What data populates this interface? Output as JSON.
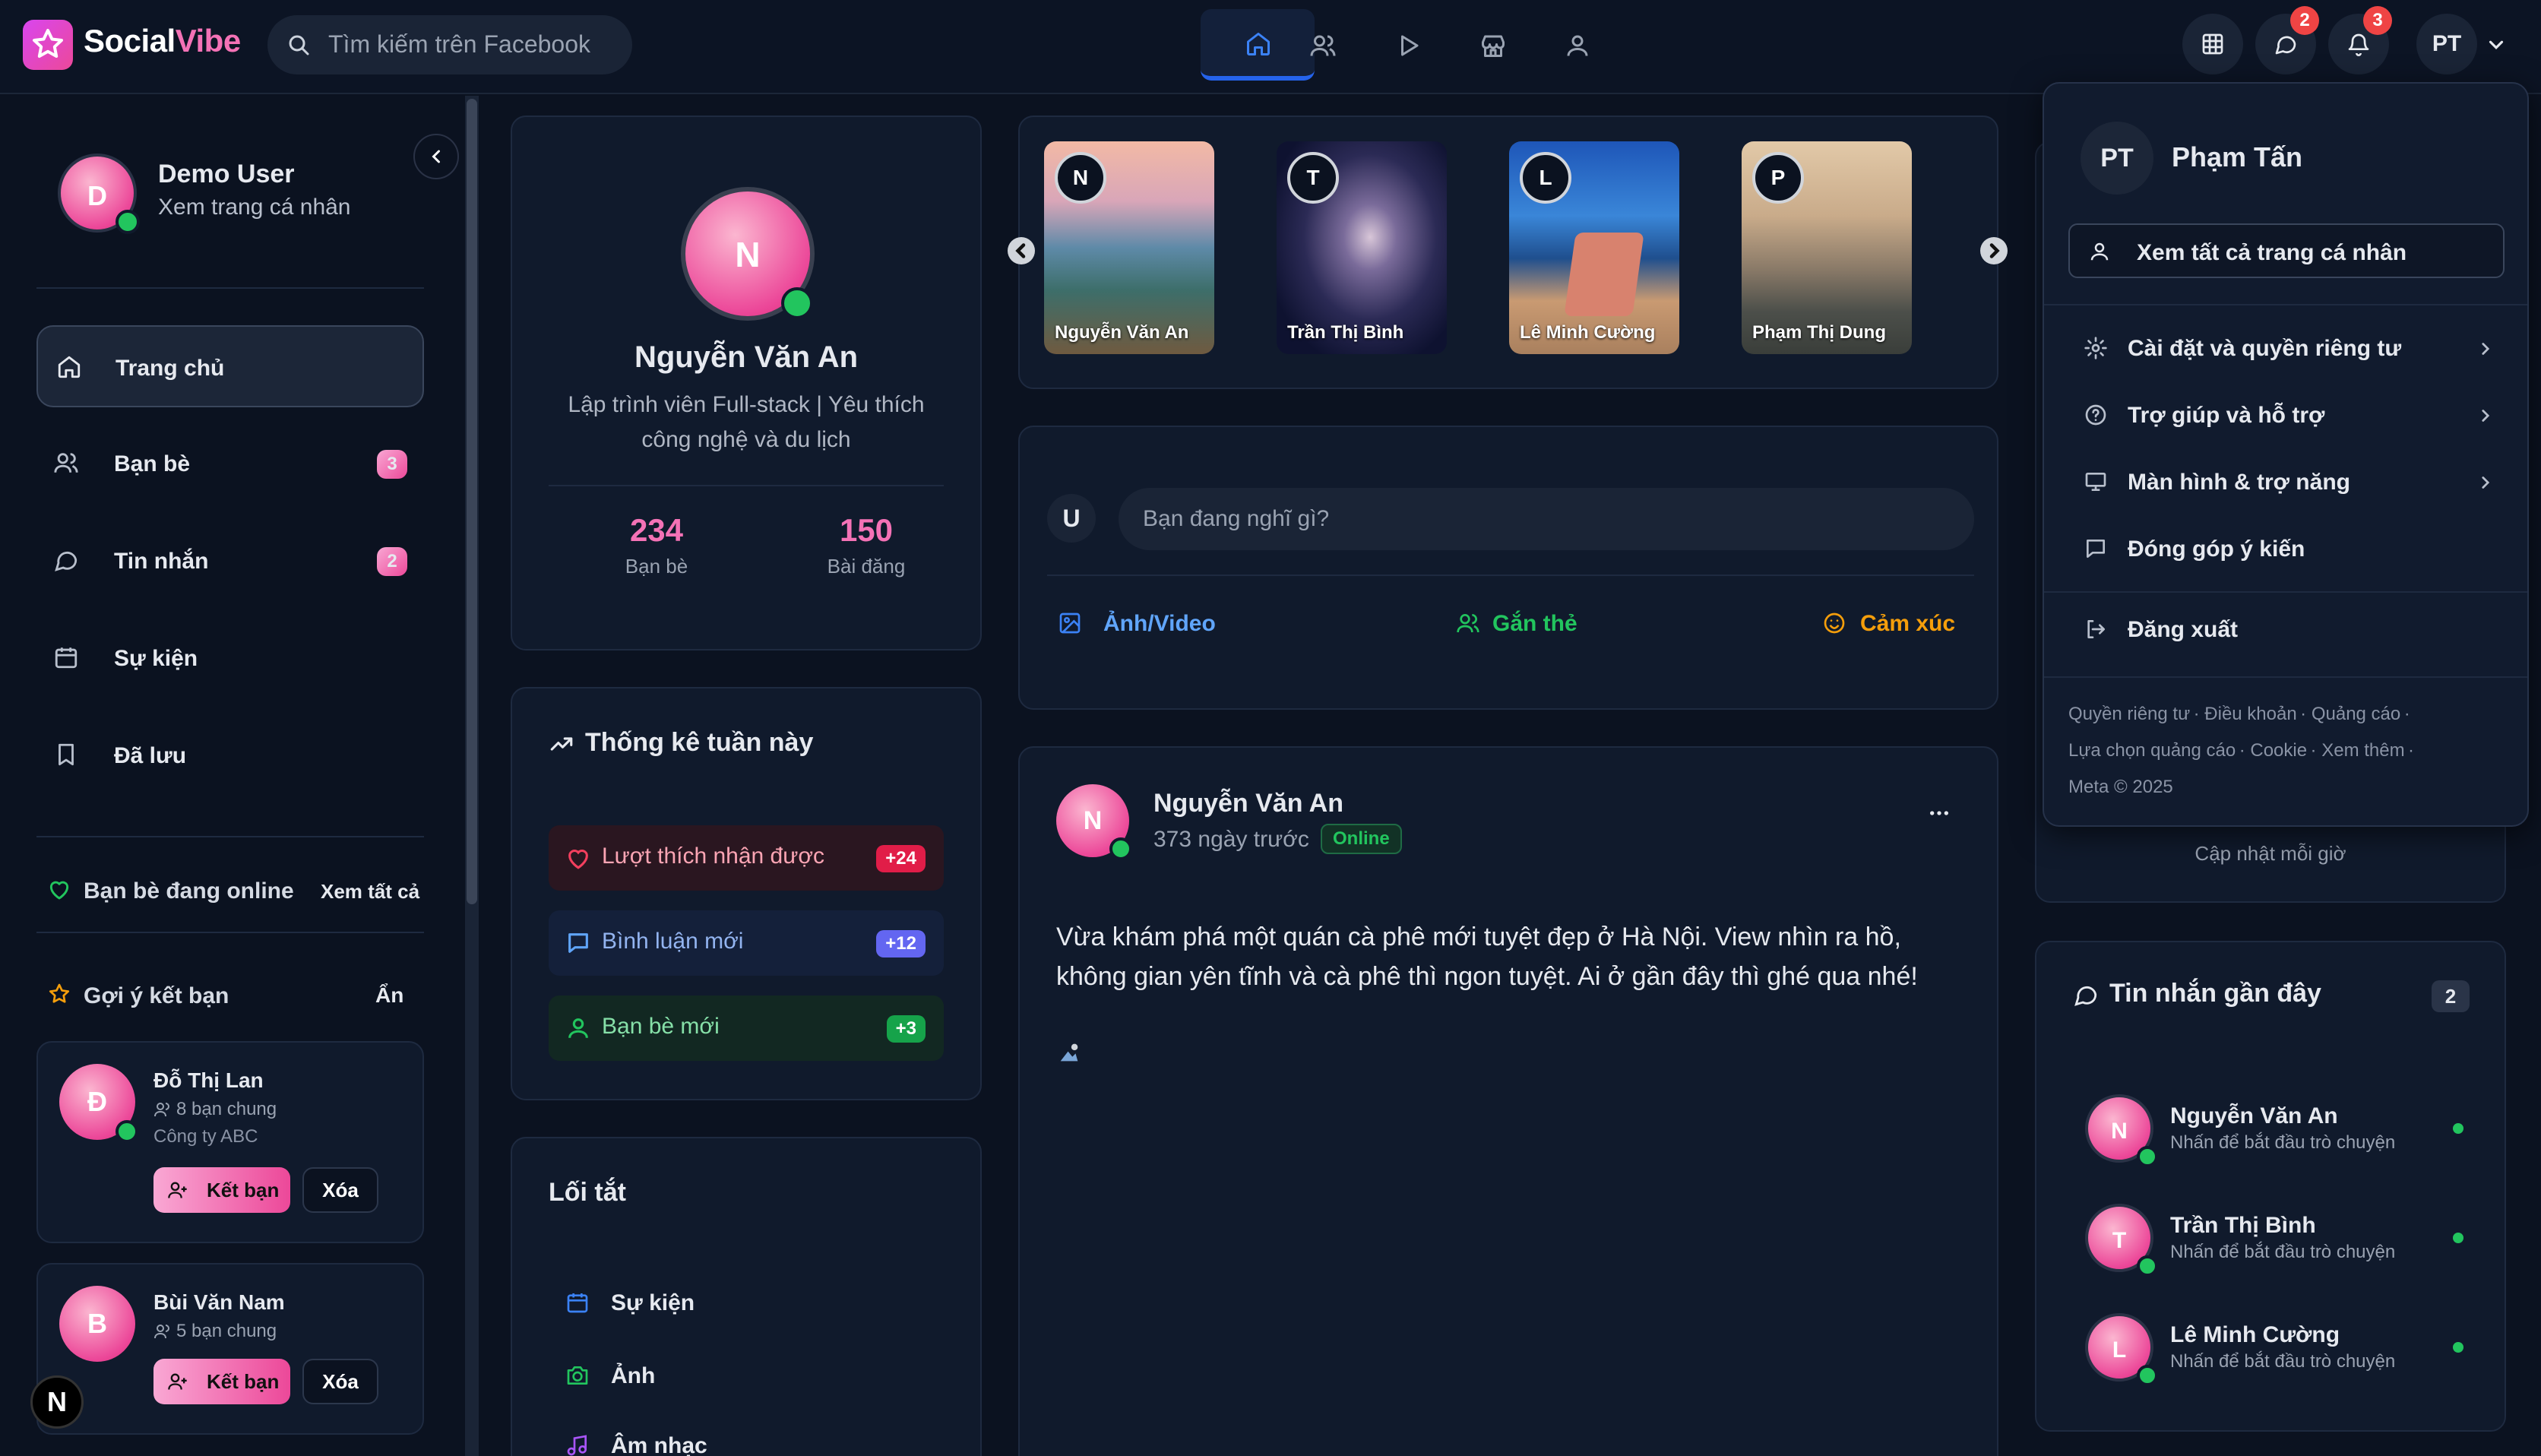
{
  "app": {
    "brand": "SocialVibe",
    "brand_a": "Social",
    "brand_b": "Vibe"
  },
  "search": {
    "placeholder": "Tìm kiếm trên Facebook"
  },
  "header": {
    "nav_tabs": [
      "home",
      "friends",
      "watch",
      "marketplace",
      "groups"
    ],
    "messages_badge": "2",
    "notifications_badge": "3",
    "user_initials": "PT"
  },
  "sidebar": {
    "user": {
      "initial": "D",
      "name": "Demo User",
      "subtitle": "Xem trang cá nhân"
    },
    "menu": [
      {
        "label": "Trang chủ",
        "icon": "home-icon"
      },
      {
        "label": "Bạn bè",
        "icon": "users-icon",
        "badge": "3"
      },
      {
        "label": "Tin nhắn",
        "icon": "message-icon",
        "badge": "2"
      },
      {
        "label": "Sự kiện",
        "icon": "calendar-icon"
      },
      {
        "label": "Đã lưu",
        "icon": "bookmark-icon"
      }
    ],
    "online_title": "Bạn bè đang online",
    "online_link": "Xem tất cả",
    "suggest_title": "Gợi ý kết bạn",
    "suggest_hide": "Ẩn",
    "suggestions": [
      {
        "initial": "Đ",
        "name": "Đỗ Thị Lan",
        "mutual": "8 bạn chung",
        "work": "Công ty ABC",
        "add": "Kết bạn",
        "remove": "Xóa"
      },
      {
        "initial": "B",
        "name": "Bùi Văn Nam",
        "mutual": "5 bạn chung",
        "add": "Kết bạn",
        "remove": "Xóa"
      }
    ],
    "floating_badge": "N"
  },
  "profile": {
    "initial": "N",
    "name": "Nguyễn Văn An",
    "bio_line1": "Lập trình viên Full-stack | Yêu thích",
    "bio_line2": "công nghệ và du lịch",
    "friends_count": "234",
    "friends_label": "Bạn bè",
    "posts_count": "150",
    "posts_label": "Bài đăng"
  },
  "weekly": {
    "title": "Thống kê tuần này",
    "rows": [
      {
        "label": "Lượt thích nhận được",
        "value": "+24",
        "color": "#e11d48"
      },
      {
        "label": "Bình luận mới",
        "value": "+12",
        "color": "#6366f1"
      },
      {
        "label": "Bạn bè mới",
        "value": "+3",
        "color": "#16a34a"
      }
    ]
  },
  "shortcuts": {
    "title": "Lối tắt",
    "items": [
      "Sự kiện",
      "Ảnh",
      "Âm nhạc"
    ]
  },
  "stories": [
    {
      "initial": "N",
      "name": "Nguyễn Văn An"
    },
    {
      "initial": "T",
      "name": "Trần Thị Bình"
    },
    {
      "initial": "L",
      "name": "Lê Minh Cường"
    },
    {
      "initial": "P",
      "name": "Phạm Thị Dung"
    }
  ],
  "composer": {
    "avatar": "U",
    "placeholder": "Bạn đang nghĩ gì?",
    "photo": "Ảnh/Video",
    "tag": "Gắn thẻ",
    "feeling": "Cảm xúc"
  },
  "post": {
    "initial": "N",
    "author": "Nguyễn Văn An",
    "time": "373 ngày trước",
    "status": "Online",
    "line1": "Vừa khám phá một quán cà phê mới tuyệt đẹp ở Hà Nội. View nhìn ra hồ,",
    "line2": "không gian yên tĩnh và cà phê thì ngon tuyệt. Ai ở gần đây thì ghé qua nhé!"
  },
  "dropdown": {
    "initials": "PT",
    "name": "Phạm Tấn",
    "view_all": "Xem tất cả trang cá nhân",
    "items": [
      {
        "label": "Cài đặt và quyền riêng tư",
        "icon": "gear-icon"
      },
      {
        "label": "Trợ giúp và hỗ trợ",
        "icon": "help-icon"
      },
      {
        "label": "Màn hình & trợ năng",
        "icon": "monitor-icon"
      },
      {
        "label": "Đóng góp ý kiến",
        "icon": "feedback-icon"
      },
      {
        "label": "Đăng xuất",
        "icon": "logout-icon"
      }
    ],
    "footer_line1": [
      "Quyền riêng tư",
      "Điều khoản",
      "Quảng cáo"
    ],
    "footer_line2": [
      "Lựa chọn quảng cáo",
      "Cookie",
      "Xem thêm"
    ],
    "footer_line3": "Meta © 2025"
  },
  "right_panel": {
    "update_note": "Cập nhật mỗi giờ",
    "messages_title": "Tin nhắn gần đây",
    "messages_count": "2",
    "messages": [
      {
        "initial": "N",
        "name": "Nguyễn Văn An",
        "sub": "Nhấn để bắt đầu trò chuyện"
      },
      {
        "initial": "T",
        "name": "Trần Thị Bình",
        "sub": "Nhấn để bắt đầu trò chuyện"
      },
      {
        "initial": "L",
        "name": "Lê Minh Cường",
        "sub": "Nhấn để bắt đầu trò chuyện"
      }
    ]
  },
  "colors": {
    "accent": "#2563eb",
    "brand_pink": "#ec4899",
    "online": "#22c55e",
    "bg": "#0b1220",
    "card": "#101a2c"
  }
}
